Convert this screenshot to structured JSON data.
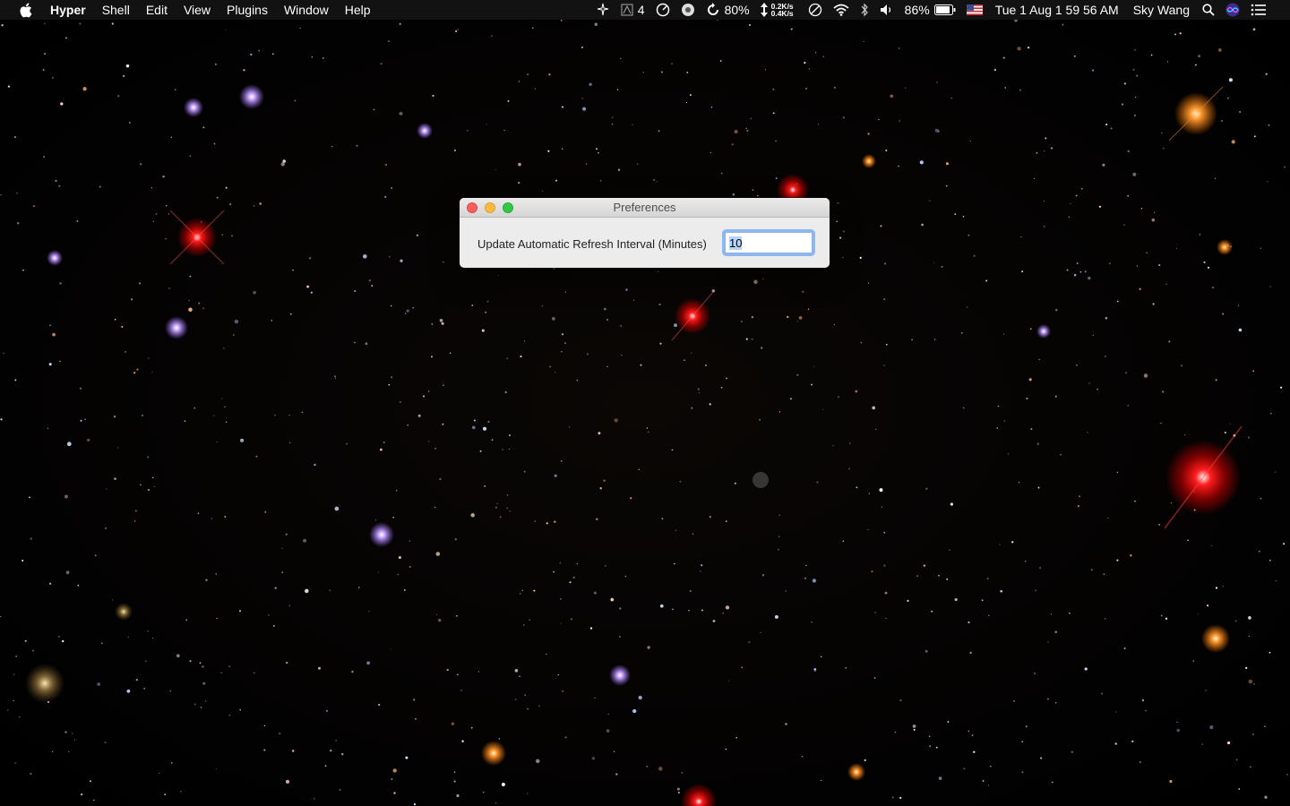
{
  "menubar": {
    "app_name": "Hyper",
    "menus": [
      "Shell",
      "Edit",
      "View",
      "Plugins",
      "Window",
      "Help"
    ],
    "status": {
      "display_count": "4",
      "cpu_percent": "80%",
      "net_up": "0.2K/s",
      "net_down": "0.4K/s",
      "battery_percent": "86%",
      "clock": "Tue 1 Aug  1 59 56 AM",
      "user": "Sky Wang"
    },
    "icons": [
      "apple-icon",
      "sparkle-icon",
      "display-icon",
      "gauge-icon",
      "camera-aperture-icon",
      "refresh-icon",
      "updown-arrows-icon",
      "clock-circle-icon",
      "wifi-icon",
      "bluetooth-icon",
      "volume-icon",
      "battery-icon",
      "us-flag-icon",
      "search-icon",
      "siri-icon",
      "notification-list-icon"
    ]
  },
  "window": {
    "title": "Preferences",
    "field_label": "Update Automatic Refresh Interval (Minutes)",
    "field_value": "10"
  },
  "colors": {
    "close": "#fc605c",
    "minimize": "#fdbc40",
    "maximize": "#34c84a",
    "focus_ring": "#8db7f1"
  }
}
